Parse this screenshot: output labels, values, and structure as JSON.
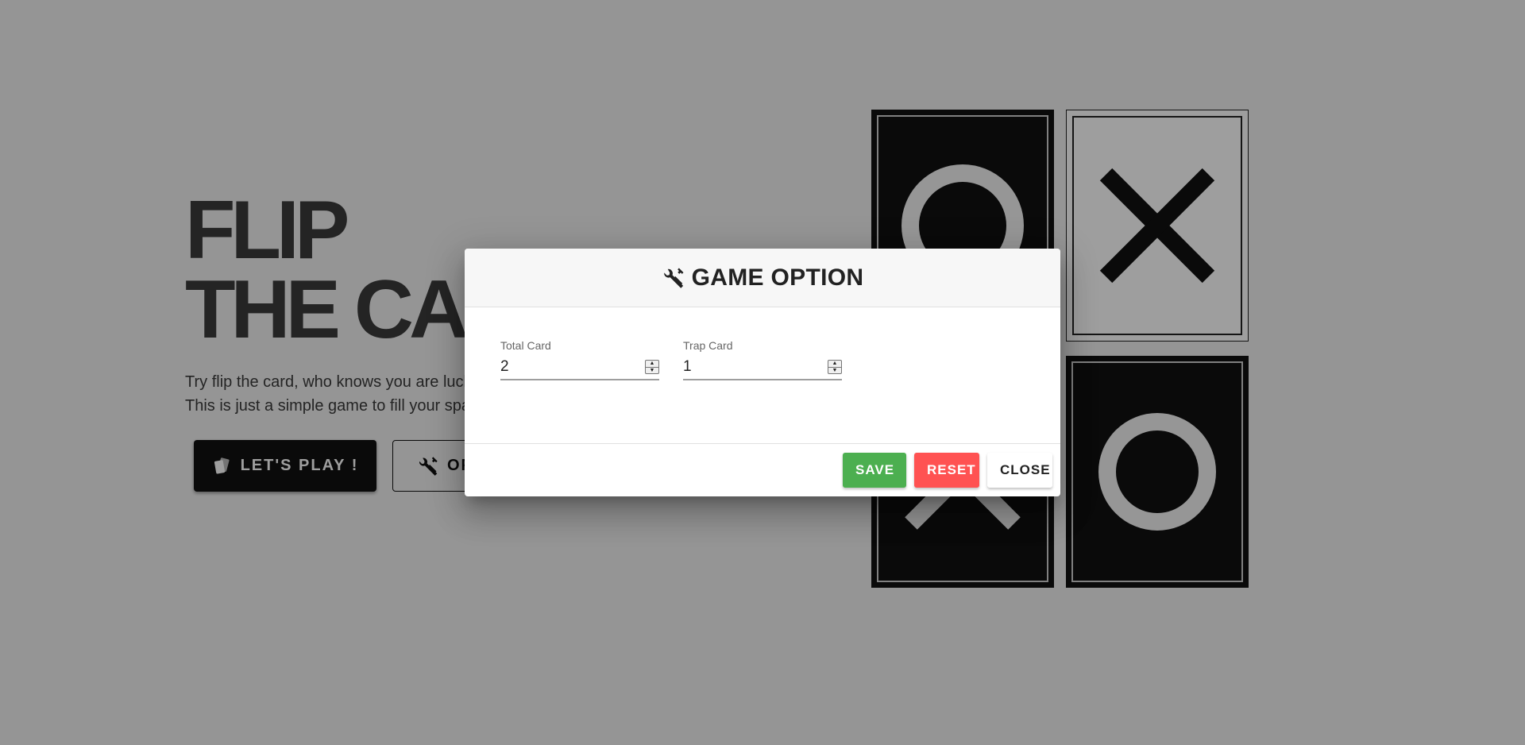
{
  "hero": {
    "title_line1": "FLIP",
    "title_line2": "THE CARD",
    "desc_line1": "Try flip the card, who knows you are lucky",
    "desc_line2": "This is just a simple game to fill your spare time",
    "play_label": "LET'S PLAY !",
    "option_label": "OPTION"
  },
  "cards": [
    {
      "symbol": "circle",
      "theme": "dark"
    },
    {
      "symbol": "cross",
      "theme": "light"
    },
    {
      "symbol": "cross",
      "theme": "dark"
    },
    {
      "symbol": "circle",
      "theme": "dark"
    }
  ],
  "modal": {
    "title": "GAME OPTION",
    "total_card": {
      "label": "Total Card",
      "value": "2"
    },
    "trap_card": {
      "label": "Trap Card",
      "value": "1"
    },
    "save_label": "SAVE",
    "reset_label": "RESET",
    "close_label": "CLOSE"
  },
  "colors": {
    "save": "#4caf50",
    "reset": "#ff5252",
    "card_dark": "#111111",
    "overlay": "rgba(0,0,0,0.38)"
  },
  "icons": [
    "cards-icon",
    "tools-icon"
  ]
}
